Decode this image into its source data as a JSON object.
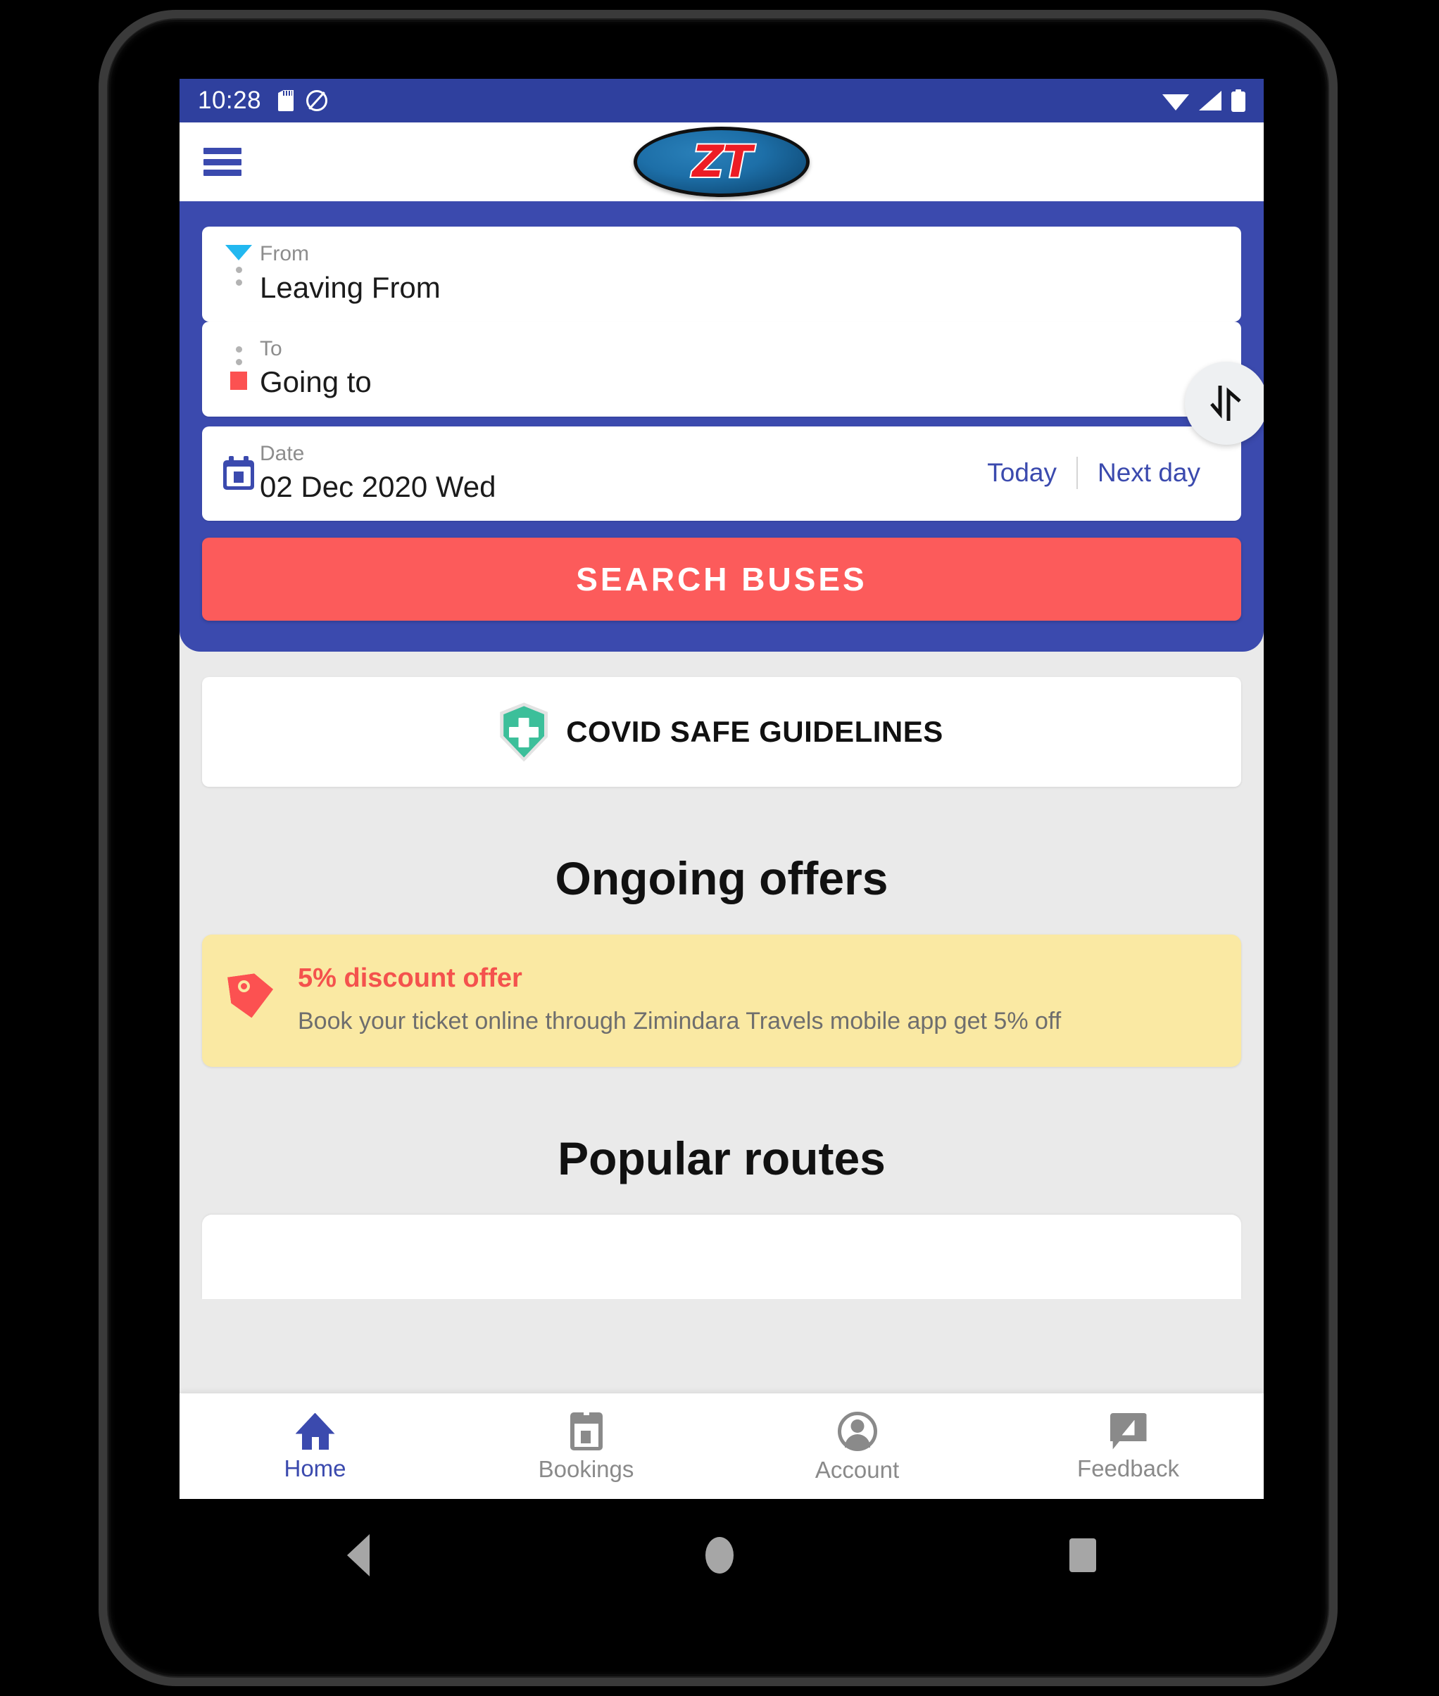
{
  "statusbar": {
    "time": "10:28",
    "icons": [
      "sd-card-icon",
      "screenshot-icon",
      "wifi-icon",
      "signal-icon",
      "battery-icon"
    ]
  },
  "appbar": {
    "menu_icon": "hamburger-menu-icon",
    "logo_text": "ZT"
  },
  "search_panel": {
    "from": {
      "label": "From",
      "value": "Leaving From"
    },
    "to": {
      "label": "To",
      "value": "Going to"
    },
    "date": {
      "label": "Date",
      "value": "02 Dec 2020 Wed",
      "today_label": "Today",
      "next_day_label": "Next day"
    },
    "swap_icon": "swap-vertical-icon",
    "search_button": "SEARCH BUSES"
  },
  "covid": {
    "icon": "shield-plus-icon",
    "label": "COVID SAFE GUIDELINES"
  },
  "offers": {
    "heading": "Ongoing offers",
    "items": [
      {
        "icon": "price-tag-icon",
        "title": "5% discount offer",
        "description": "Book your ticket online through Zimindara Travels mobile app get 5% off"
      }
    ]
  },
  "routes": {
    "heading": "Popular routes"
  },
  "bottom_nav": {
    "items": [
      {
        "label": "Home",
        "icon": "home-icon",
        "active": true
      },
      {
        "label": "Bookings",
        "icon": "bookings-calendar-icon",
        "active": false
      },
      {
        "label": "Account",
        "icon": "account-person-icon",
        "active": false
      },
      {
        "label": "Feedback",
        "icon": "feedback-edit-icon",
        "active": false
      }
    ]
  },
  "android_nav": {
    "back": "back-triangle-icon",
    "home": "home-circle-icon",
    "recents": "recents-square-icon"
  },
  "colors": {
    "status_bar": "#2f409e",
    "primary_blue": "#3b4aae",
    "accent_red": "#fc5b5b",
    "offer_yellow": "#fae9a3",
    "shield_green": "#3cbf9a",
    "page_bg": "#eaeaea"
  }
}
